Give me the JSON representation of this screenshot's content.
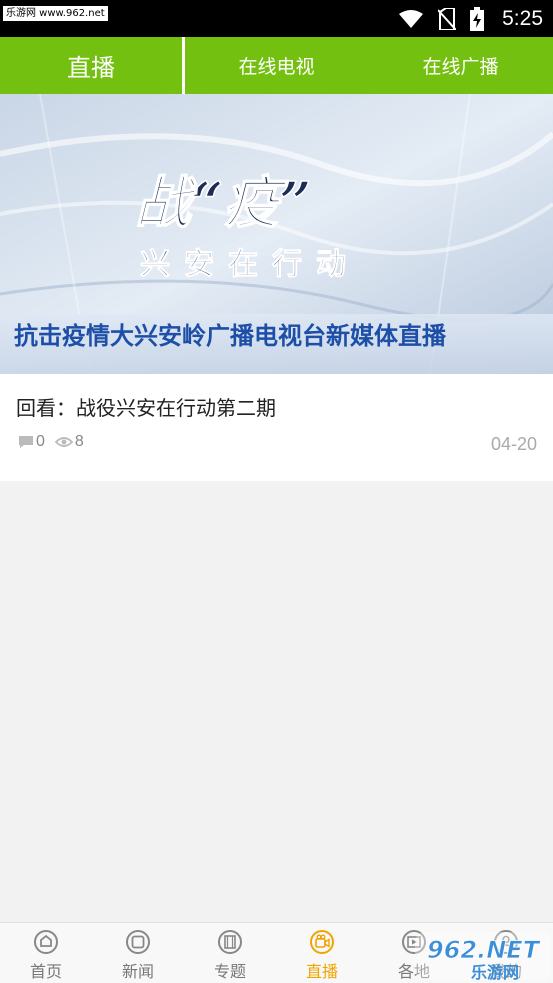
{
  "status_bar": {
    "watermark": "乐游网 www.962.net",
    "time": "5:25"
  },
  "top_tabs": [
    {
      "label": "直播"
    },
    {
      "label": "在线电视"
    },
    {
      "label": "在线广播"
    }
  ],
  "banner": {
    "headline": "战“疫”",
    "subline": "兴安在行动",
    "caption": "抗击疫情大兴安岭广播电视台新媒体直播"
  },
  "card": {
    "title": "回看：战役兴安在行动第二期",
    "comments": "0",
    "views": "8",
    "date": "04-20"
  },
  "bottom_nav": [
    {
      "label": "首页"
    },
    {
      "label": "新闻"
    },
    {
      "label": "专题"
    },
    {
      "label": "直播"
    },
    {
      "label": "各地"
    },
    {
      "label": "我的"
    }
  ],
  "watermark_br": "962.NET 乐游网",
  "colors": {
    "accent_green": "#74c011",
    "active_nav": "#f0a400"
  }
}
